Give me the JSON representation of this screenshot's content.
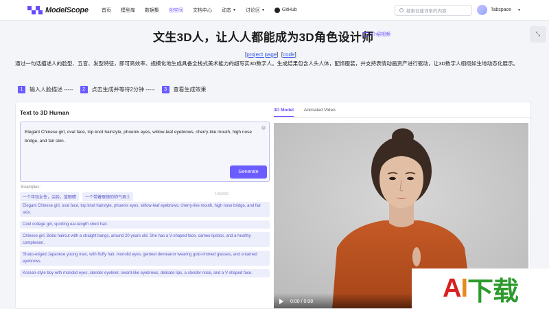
{
  "nav": {
    "logo": "ModelScope",
    "items": [
      "首页",
      "模型库",
      "数据集",
      "创空间",
      "文档中心",
      "动态",
      "讨论区",
      "GitHub"
    ],
    "search_placeholder": "搜索创建词条的内容",
    "username": "Tabspace",
    "accent_color": "#624aff"
  },
  "header": {
    "title": "文生3D人，让人人都能成为3D角色设计师",
    "video_link": "介绍视频",
    "project_link": "project page",
    "code_link": "code",
    "description": "通过一句话描述人的脸型、五官、发型特征，即可高效率、规模化地生成具备全栈式美术能力的超写实3D数字人。生成结果包含人头人体，配饰服装，并支持表情动画资产进行驱动，让3D数字人栩栩如生地动态化展示。"
  },
  "steps": [
    {
      "num": "1",
      "text": "输入人脸描述 -----"
    },
    {
      "num": "2",
      "text": "点击生成并等待2分钟 -----"
    },
    {
      "num": "3",
      "text": "查看生成效果"
    }
  ],
  "left_panel": {
    "title": "Text to 3D Human",
    "input_value": "Elegant Chinese girl, oval face, top knot hairstyle, phoenix eyes, willow-leaf eyebrows, cherry-like mouth, high nose bridge, and fair skin.",
    "counter": "146/500",
    "generate_label": "Generate",
    "examples_label": "Examples:",
    "chips": [
      "一个年轻女性，尖脸，蓝眼睛",
      "一个带着眼镜的帅气男士"
    ],
    "examples": [
      "Elegant Chinese girl, oval face, top knot hairstyle, phoenix eyes, willow-leaf eyebrows, cherry-like mouth, high nose bridge, and fair skin.",
      "Cool college girl, sporting ear-length short hair.",
      "Chinese girl, Bobo haircut with a straight bangs, around 20 years old. She has a V-shaped face, cameo lipstick, and a healthy complexion.",
      "Sharp-edged Japanese young man, with fluffy hair, monolid eyes, genteel demeanor wearing gold-rimmed glasses, and untamed eyebrows.",
      "Korean-style boy with monolid eyes, slender eyeliner, sword-like eyebrows, delicate lips, a slender nose, and a V-shaped face."
    ]
  },
  "right_panel": {
    "tabs": [
      "3D Model",
      "Animated Video"
    ],
    "video_time": "0:00 / 0:08"
  },
  "watermark": {
    "a": "A",
    "i": "I",
    "zh": "下载"
  }
}
